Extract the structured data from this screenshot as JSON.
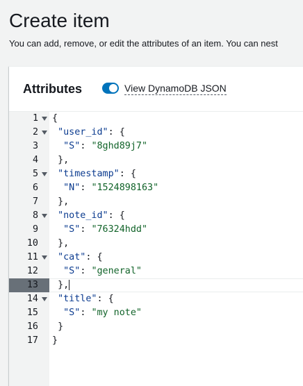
{
  "page": {
    "title": "Create item",
    "description": "You can add, remove, or edit the attributes of an item. You can nest"
  },
  "panel": {
    "title": "Attributes",
    "toggle_label": "View DynamoDB JSON",
    "toggle_on": true
  },
  "editor": {
    "active_line": 13,
    "lines": [
      {
        "n": "1",
        "fold": true,
        "indent": "",
        "key": "",
        "sep": "",
        "val": "",
        "tail": "{"
      },
      {
        "n": "2",
        "fold": true,
        "indent": " ",
        "key": "\"user_id\"",
        "sep": ": ",
        "val": "",
        "tail": "{"
      },
      {
        "n": "3",
        "fold": false,
        "indent": "  ",
        "key": "\"S\"",
        "sep": ": ",
        "val": "\"8ghd89j7\"",
        "tail": ""
      },
      {
        "n": "4",
        "fold": false,
        "indent": " ",
        "key": "",
        "sep": "",
        "val": "",
        "tail": "},"
      },
      {
        "n": "5",
        "fold": true,
        "indent": " ",
        "key": "\"timestamp\"",
        "sep": ": ",
        "val": "",
        "tail": "{"
      },
      {
        "n": "6",
        "fold": false,
        "indent": "  ",
        "key": "\"N\"",
        "sep": ": ",
        "val": "\"1524898163\"",
        "tail": ""
      },
      {
        "n": "7",
        "fold": false,
        "indent": " ",
        "key": "",
        "sep": "",
        "val": "",
        "tail": "},"
      },
      {
        "n": "8",
        "fold": true,
        "indent": " ",
        "key": "\"note_id\"",
        "sep": ": ",
        "val": "",
        "tail": "{"
      },
      {
        "n": "9",
        "fold": false,
        "indent": "  ",
        "key": "\"S\"",
        "sep": ": ",
        "val": "\"76324hdd\"",
        "tail": ""
      },
      {
        "n": "10",
        "fold": false,
        "indent": " ",
        "key": "",
        "sep": "",
        "val": "",
        "tail": "},"
      },
      {
        "n": "11",
        "fold": true,
        "indent": " ",
        "key": "\"cat\"",
        "sep": ": ",
        "val": "",
        "tail": "{"
      },
      {
        "n": "12",
        "fold": false,
        "indent": "  ",
        "key": "\"S\"",
        "sep": ": ",
        "val": "\"general\"",
        "tail": ""
      },
      {
        "n": "13",
        "fold": false,
        "indent": " ",
        "key": "",
        "sep": "",
        "val": "",
        "tail": "},"
      },
      {
        "n": "14",
        "fold": true,
        "indent": " ",
        "key": "\"title\"",
        "sep": ": ",
        "val": "",
        "tail": "{"
      },
      {
        "n": "15",
        "fold": false,
        "indent": "  ",
        "key": "\"S\"",
        "sep": ": ",
        "val": "\"my note\"",
        "tail": ""
      },
      {
        "n": "16",
        "fold": false,
        "indent": " ",
        "key": "",
        "sep": "",
        "val": "",
        "tail": "}"
      },
      {
        "n": "17",
        "fold": false,
        "indent": "",
        "key": "",
        "sep": "",
        "val": "",
        "tail": "}"
      }
    ]
  }
}
